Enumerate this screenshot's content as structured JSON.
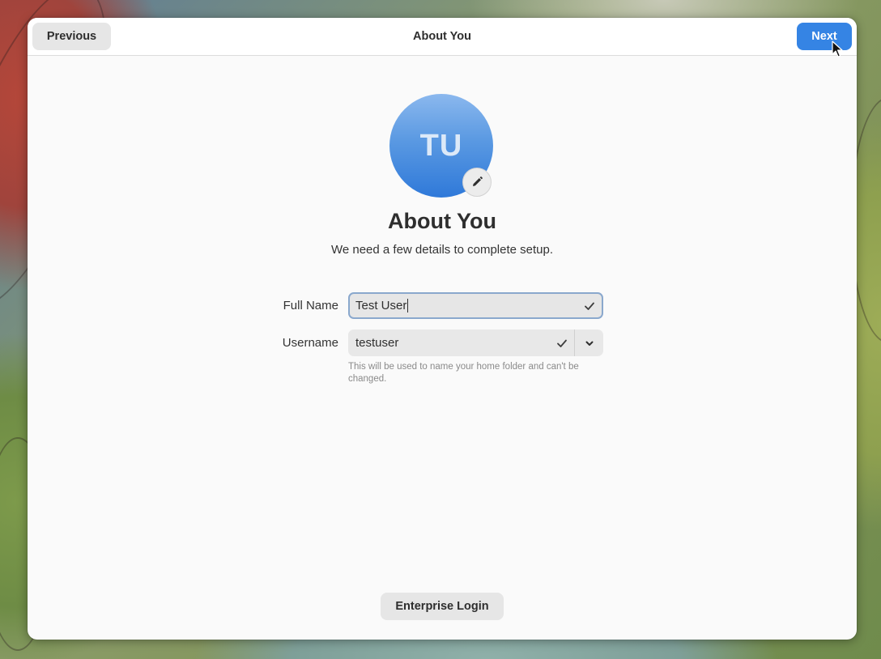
{
  "header": {
    "previous_label": "Previous",
    "title": "About You",
    "next_label": "Next"
  },
  "avatar": {
    "initials": "TU",
    "edit_icon": "pencil-icon"
  },
  "page": {
    "title": "About You",
    "subtitle": "We need a few details to complete setup."
  },
  "form": {
    "full_name": {
      "label": "Full Name",
      "value": "Test User",
      "status_icon": "checkmark-icon"
    },
    "username": {
      "label": "Username",
      "value": "testuser",
      "status_icon": "checkmark-icon",
      "dropdown_icon": "chevron-down-icon",
      "hint": "This will be used to name your home folder and can't be changed."
    }
  },
  "footer": {
    "enterprise_login_label": "Enterprise Login"
  },
  "colors": {
    "accent": "#3584e4",
    "avatar_top": "#8bb8ee",
    "avatar_bottom": "#2f79d9",
    "dialog_bg": "#fafafa"
  }
}
